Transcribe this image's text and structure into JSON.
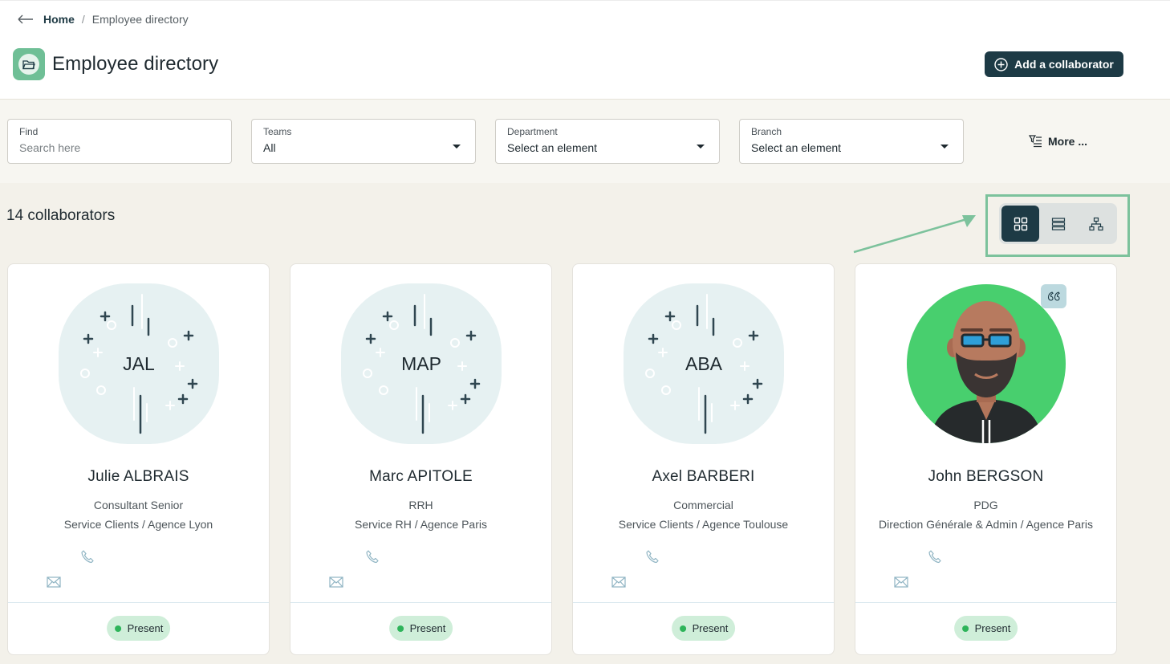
{
  "breadcrumb": {
    "home": "Home",
    "separator": "/",
    "current": "Employee directory"
  },
  "header": {
    "title": "Employee directory",
    "add_button": "Add a collaborator"
  },
  "filters": {
    "find": {
      "label": "Find",
      "placeholder": "Search here"
    },
    "teams": {
      "label": "Teams",
      "value": "All"
    },
    "department": {
      "label": "Department",
      "value": "Select an element"
    },
    "branch": {
      "label": "Branch",
      "value": "Select an element"
    },
    "more": "More ..."
  },
  "list": {
    "count_label": "14 collaborators",
    "active_view": "grid"
  },
  "colors": {
    "primary": "#1d3a45",
    "accent_green": "#6fbf96",
    "present_badge": "#cfeed9",
    "avatar_bg": "#e6f1f2",
    "highlight": "#7cc29c"
  },
  "employees": [
    {
      "initials": "JAL",
      "name": "Julie ALBRAIS",
      "role": "Consultant Senior",
      "team": "Service Clients / Agence Lyon",
      "status": "Present"
    },
    {
      "initials": "MAP",
      "name": "Marc APITOLE",
      "role": "RRH",
      "team": "Service RH / Agence Paris",
      "status": "Present"
    },
    {
      "initials": "ABA",
      "name": "Axel BARBERI",
      "role": "Commercial",
      "team": "Service Clients / Agence Toulouse",
      "status": "Present"
    },
    {
      "initials": "",
      "name": "John BERGSON",
      "role": "PDG",
      "team": "Direction Générale & Admin / Agence Paris",
      "status": "Present"
    }
  ]
}
